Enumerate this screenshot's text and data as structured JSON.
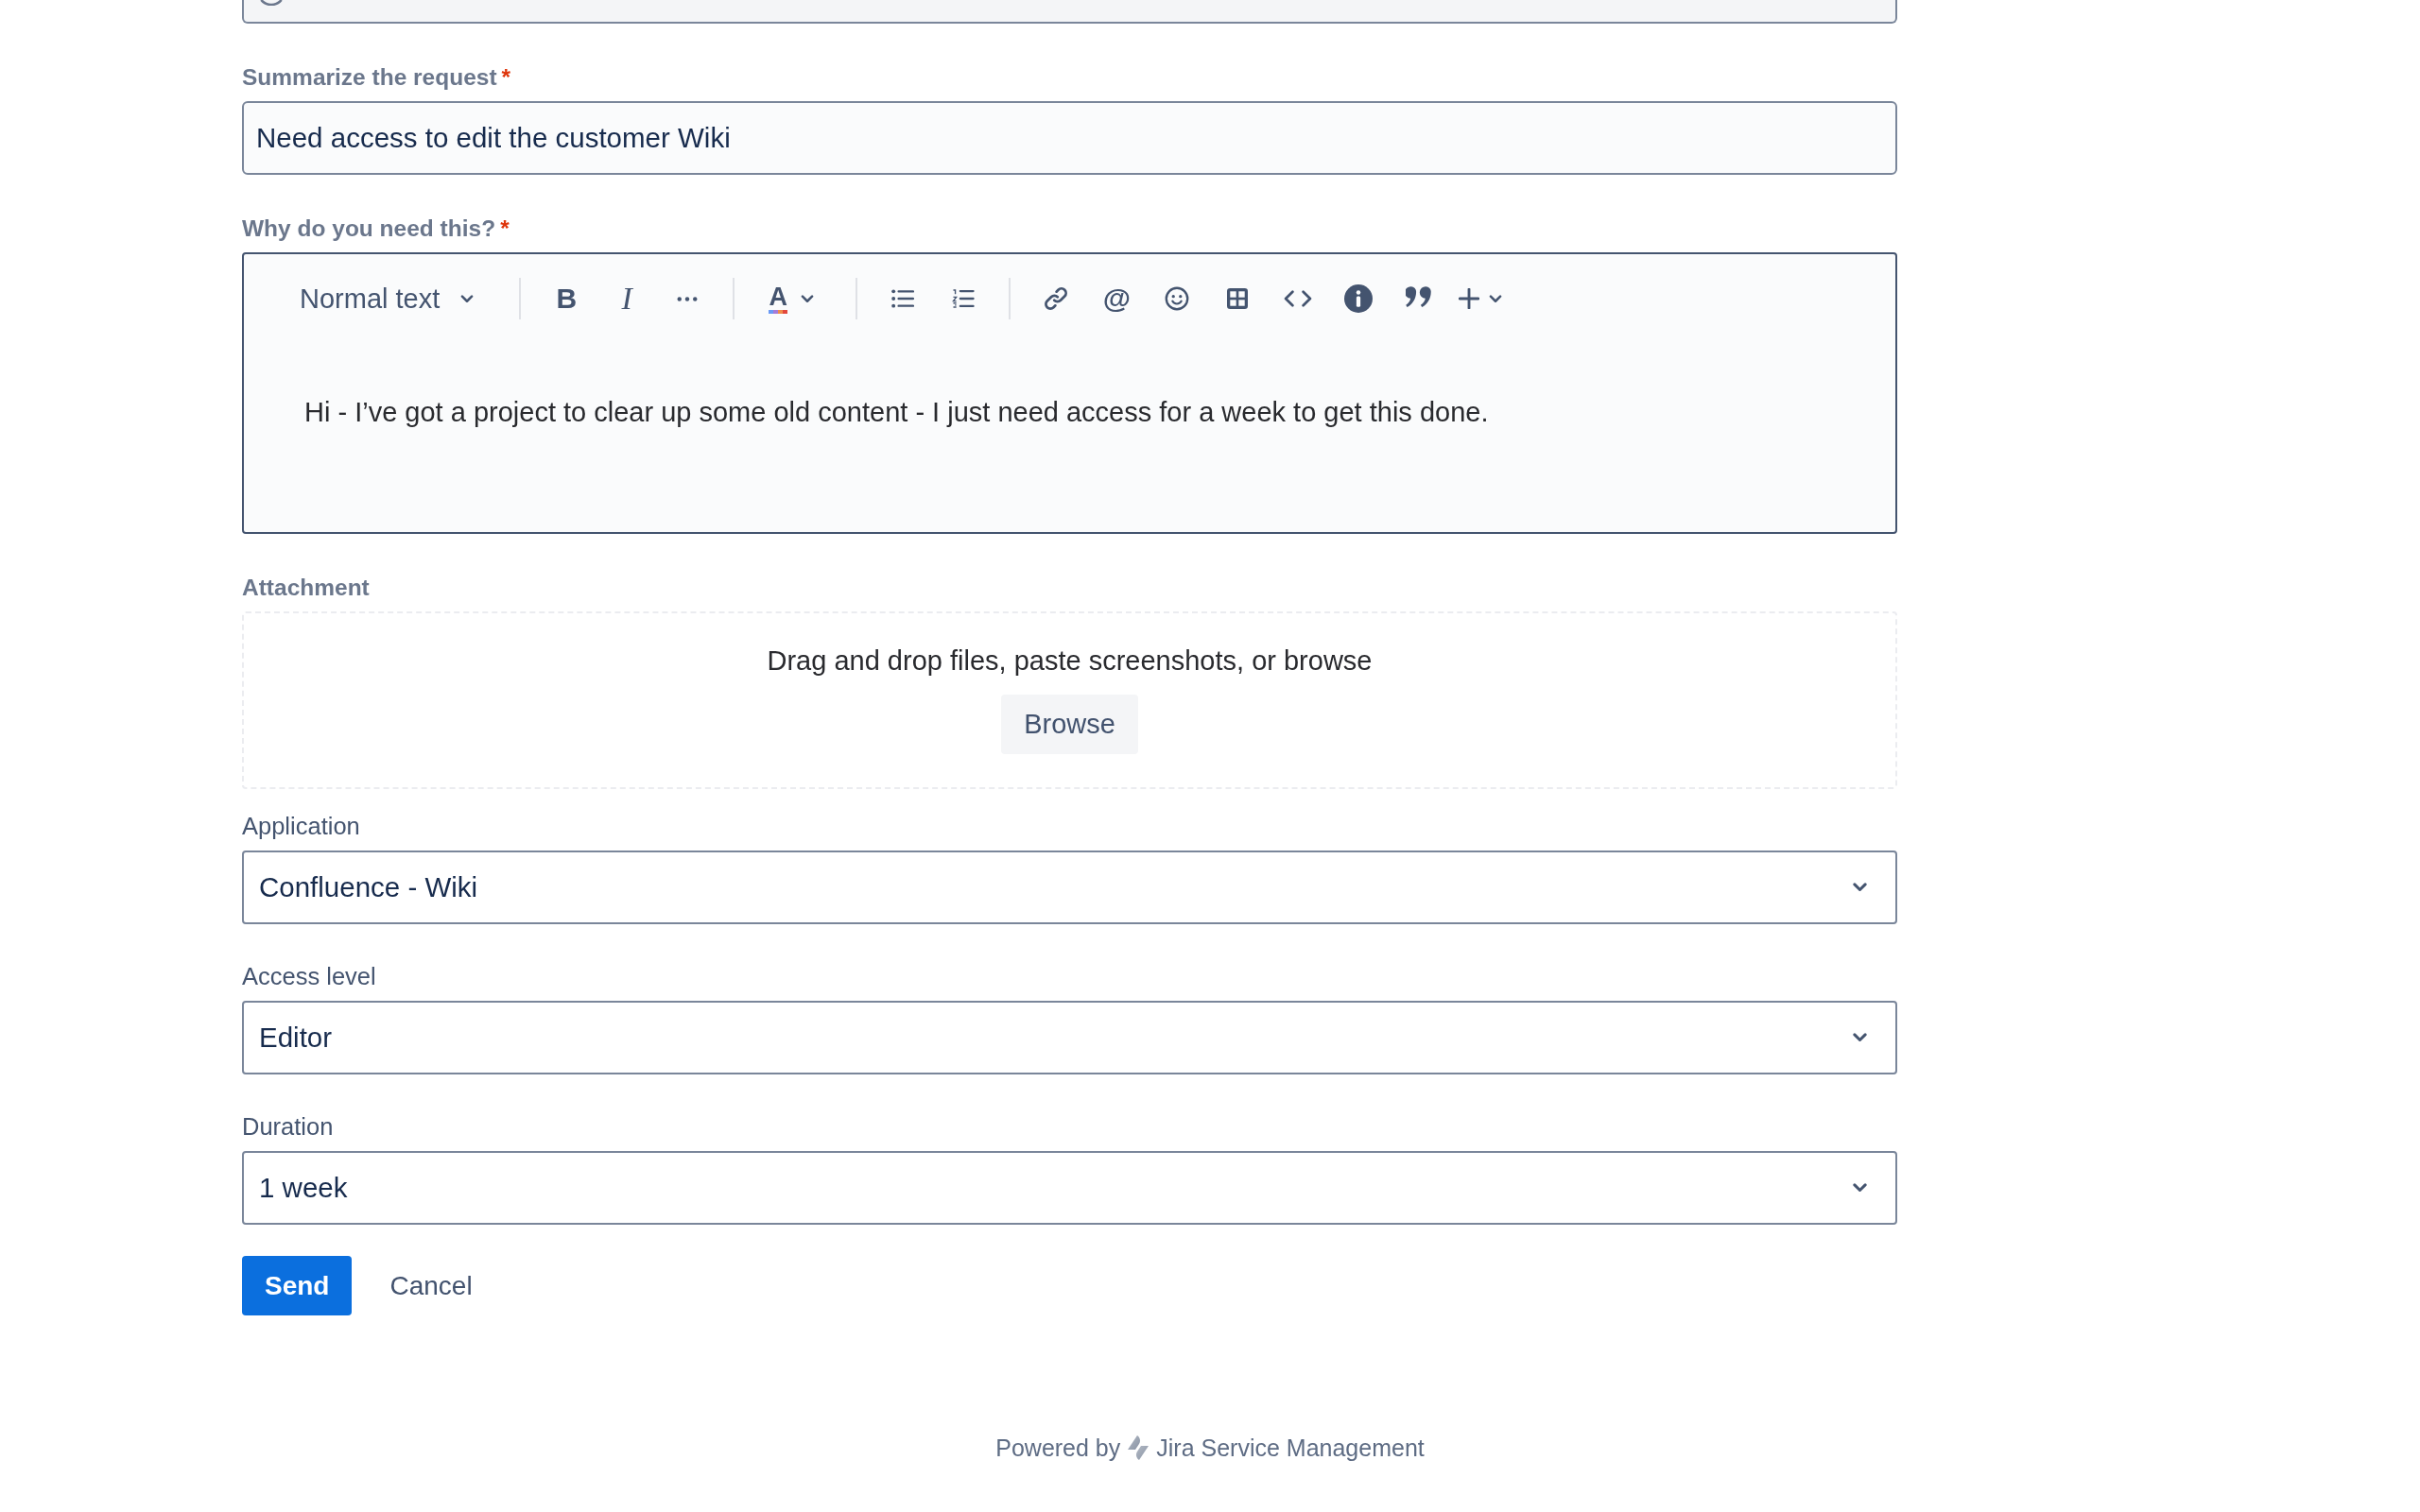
{
  "form": {
    "fields": [
      {
        "kind": "text",
        "label": "Summarize the request",
        "required_mark": "*",
        "value": "Need access to edit the customer Wiki"
      },
      {
        "kind": "rich_text",
        "label": "Why do you need this?",
        "required_mark": "*",
        "toolbar": {
          "style": "Normal text",
          "groups": [
            [
              {
                "kind": "bold",
                "glyph": "B"
              },
              {
                "kind": "italic",
                "glyph": "I"
              },
              {
                "kind": "more"
              }
            ],
            [
              {
                "kind": "text_color",
                "glyph": "A"
              }
            ],
            [
              {
                "kind": "bullet_list"
              },
              {
                "kind": "numbered_list"
              }
            ],
            [
              {
                "kind": "link"
              },
              {
                "kind": "mention",
                "glyph": "@"
              },
              {
                "kind": "emoji"
              },
              {
                "kind": "table"
              },
              {
                "kind": "code"
              },
              {
                "kind": "info"
              },
              {
                "kind": "quote"
              },
              {
                "kind": "insert"
              }
            ]
          ]
        },
        "value": "Hi - I’ve got a project to clear up some old content - I just need access for a week to get this done."
      },
      {
        "kind": "attachment",
        "label": "Attachment",
        "hint": "Drag and drop files, paste screenshots, or browse",
        "button": "Browse"
      },
      {
        "kind": "select",
        "label": "Application",
        "value": "Confluence - Wiki"
      },
      {
        "kind": "select",
        "label": "Access level",
        "value": "Editor"
      },
      {
        "kind": "select",
        "label": "Duration",
        "value": "1 week"
      }
    ],
    "buttons": [
      {
        "kind": "primary",
        "label": "Send"
      },
      {
        "kind": "subtle",
        "label": "Cancel"
      }
    ]
  },
  "footer": {
    "prefix": "Powered by",
    "product": "Jira Service Management"
  }
}
